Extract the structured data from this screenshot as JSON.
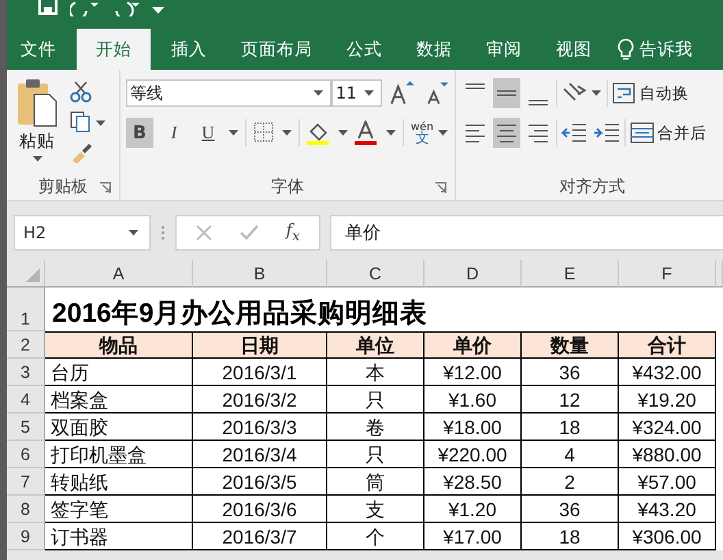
{
  "tabs": [
    {
      "label": "文件",
      "selected": false
    },
    {
      "label": "开始",
      "selected": true
    },
    {
      "label": "插入",
      "selected": false
    },
    {
      "label": "页面布局",
      "selected": false
    },
    {
      "label": "公式",
      "selected": false
    },
    {
      "label": "数据",
      "selected": false
    },
    {
      "label": "审阅",
      "selected": false
    },
    {
      "label": "视图",
      "selected": false
    }
  ],
  "tell_me": "告诉我",
  "ribbon": {
    "clipboard": {
      "paste_label": "粘贴",
      "group_label": "剪贴板"
    },
    "font": {
      "font_name": "等线",
      "font_size": "11",
      "styles": [
        {
          "label": "B",
          "kind": "bold",
          "on": true
        },
        {
          "label": "I",
          "kind": "italic",
          "on": false
        },
        {
          "label": "U",
          "kind": "underline",
          "on": false
        }
      ],
      "phonetic_top": "wén",
      "phonetic_bottom": "文",
      "group_label": "字体"
    },
    "alignment": {
      "vertical": [
        {
          "kind": "top",
          "selected": false
        },
        {
          "kind": "middle",
          "selected": true
        },
        {
          "kind": "bottom",
          "selected": false
        }
      ],
      "horizontal": [
        {
          "kind": "left",
          "selected": false
        },
        {
          "kind": "center",
          "selected": true
        },
        {
          "kind": "right",
          "selected": false
        }
      ],
      "wrap_text": "自动换",
      "merge": "合并后",
      "group_label": "对齐方式"
    }
  },
  "formula_bar": {
    "name_box": "H2",
    "fx": "f$_{x}$",
    "content": "单价"
  },
  "sheet": {
    "columns": [
      "A",
      "B",
      "C",
      "D",
      "E",
      "F"
    ],
    "title_row": {
      "number": "1",
      "title": "2016年9月办公用品采购明细表"
    },
    "header_row": {
      "number": "2",
      "cells": [
        "物品",
        "日期",
        "单位",
        "单价",
        "数量",
        "合计"
      ]
    },
    "rows": [
      {
        "number": "3",
        "cells": [
          "台历",
          "2016/3/1",
          "本",
          "¥12.00",
          "36",
          "¥432.00"
        ]
      },
      {
        "number": "4",
        "cells": [
          "档案盒",
          "2016/3/2",
          "只",
          "¥1.60",
          "12",
          "¥19.20"
        ]
      },
      {
        "number": "5",
        "cells": [
          "双面胶",
          "2016/3/3",
          "卷",
          "¥18.00",
          "18",
          "¥324.00"
        ]
      },
      {
        "number": "6",
        "cells": [
          "打印机墨盒",
          "2016/3/4",
          "只",
          "¥220.00",
          "4",
          "¥880.00"
        ]
      },
      {
        "number": "7",
        "cells": [
          "转贴纸",
          "2016/3/5",
          "筒",
          "¥28.50",
          "2",
          "¥57.00"
        ]
      },
      {
        "number": "8",
        "cells": [
          "签字笔",
          "2016/3/6",
          "支",
          "¥1.20",
          "36",
          "¥43.20"
        ]
      },
      {
        "number": "9",
        "cells": [
          "订书器",
          "2016/3/7",
          "个",
          "¥17.00",
          "18",
          "¥306.00"
        ]
      }
    ]
  }
}
